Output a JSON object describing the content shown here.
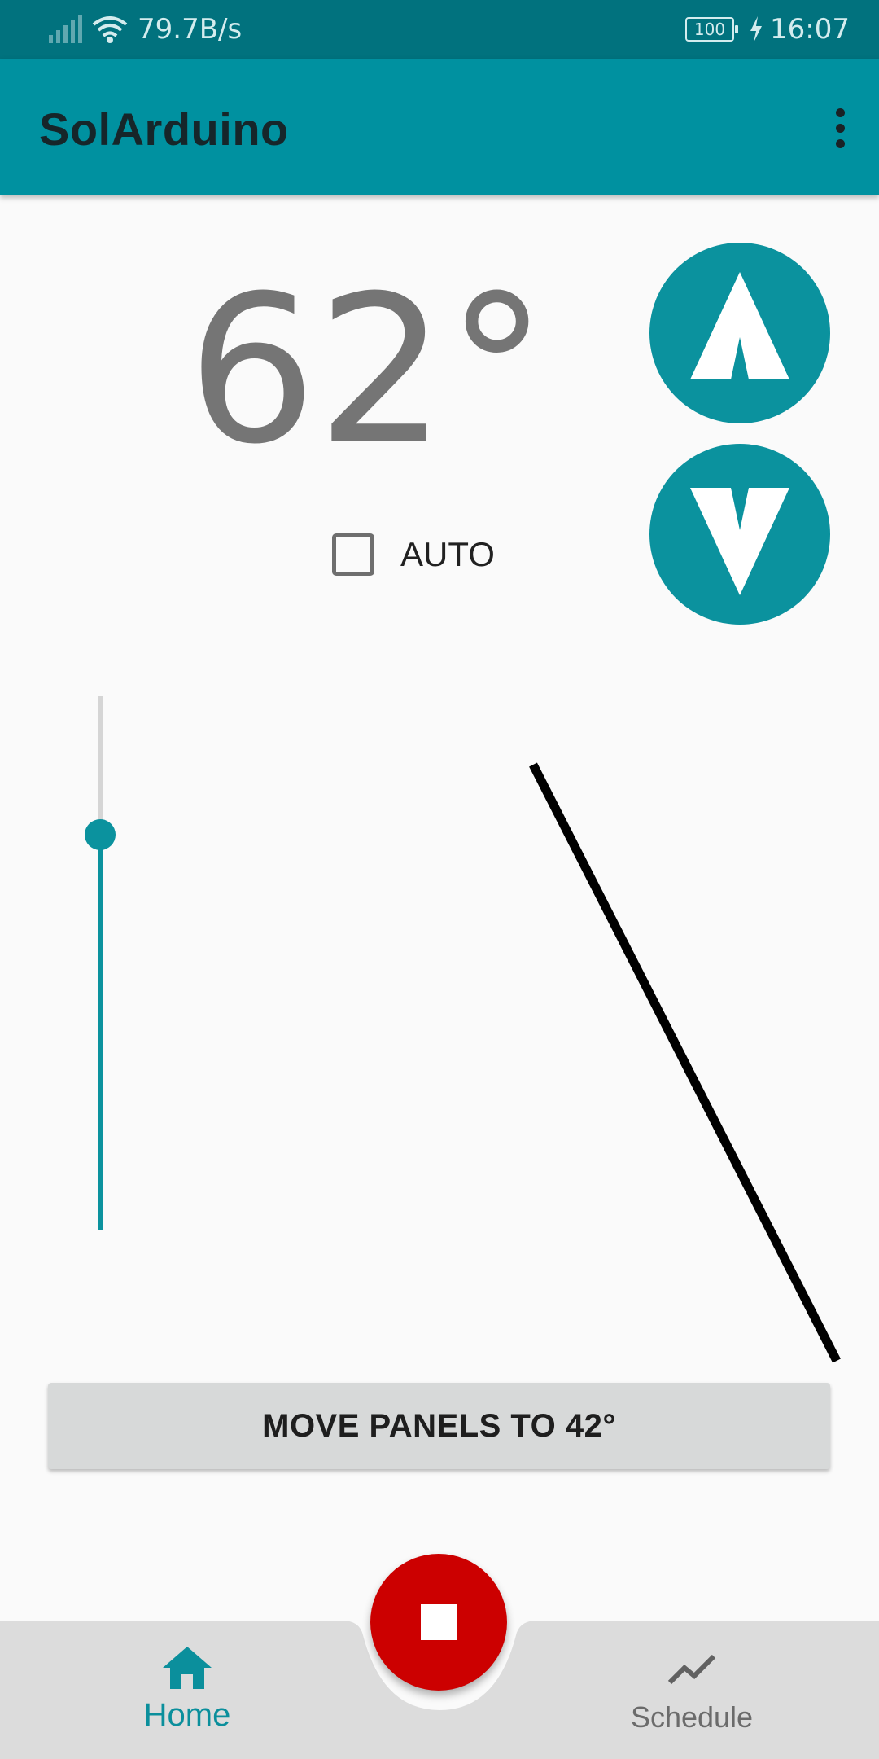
{
  "status_bar": {
    "network_speed": "79.7B/s",
    "battery_level": "100",
    "time": "16:07",
    "icons": [
      "signal-icon",
      "wifi-icon",
      "battery-icon",
      "charging-icon"
    ]
  },
  "app_bar": {
    "title": "SolArduino",
    "overflow_icon": "more-vert-icon",
    "color": "#0091a0"
  },
  "main": {
    "current_angle": "62°",
    "auto_checkbox": {
      "label": "AUTO",
      "checked": false
    },
    "up_button_icon": "arrow-up-icon",
    "down_button_icon": "arrow-down-icon",
    "slider": {
      "orientation": "vertical",
      "target_angle": 42,
      "fraction_from_top": 0.26
    },
    "panel_angle_line_color": "#000000",
    "move_button_label": "MOVE PANELS TO 42°",
    "accent_color": "#0b929e"
  },
  "stop_button": {
    "icon": "stop-icon",
    "color": "#cc0000"
  },
  "bottom_nav": {
    "items": [
      {
        "label": "Home",
        "icon": "home-icon",
        "active": true
      },
      {
        "label": "Schedule",
        "icon": "trending-icon",
        "active": false
      }
    ]
  }
}
